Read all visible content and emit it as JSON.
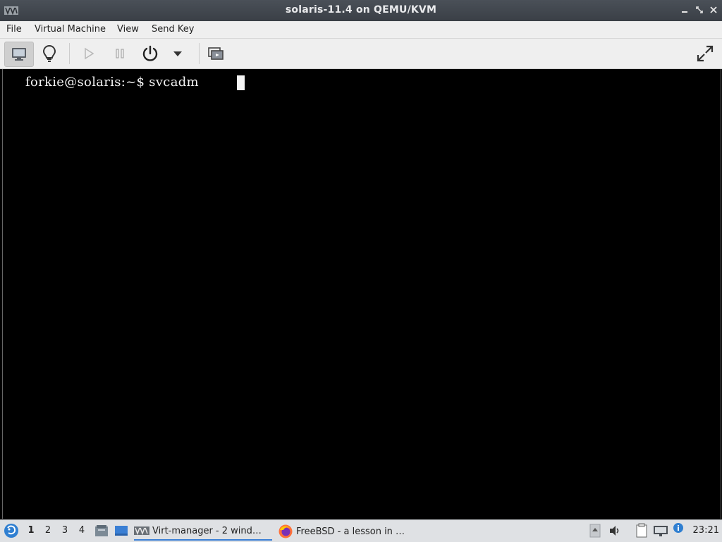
{
  "window": {
    "title": "solaris-11.4 on QEMU/KVM",
    "controls": [
      "minimize",
      "maximize",
      "close"
    ]
  },
  "menubar": {
    "items": [
      "File",
      "Virtual Machine",
      "View",
      "Send Key"
    ]
  },
  "toolbar": {
    "buttons": [
      {
        "name": "show-console",
        "icon": "monitor-icon",
        "active": true
      },
      {
        "name": "show-details",
        "icon": "lightbulb-icon",
        "active": false
      },
      {
        "name": "run",
        "icon": "play-icon",
        "enabled": false
      },
      {
        "name": "pause",
        "icon": "pause-icon",
        "enabled": false
      },
      {
        "name": "shutdown",
        "icon": "power-icon",
        "enabled": true
      },
      {
        "name": "shutdown-menu",
        "icon": "caret-down-icon",
        "enabled": true
      },
      {
        "name": "snapshots",
        "icon": "snapshot-icon",
        "enabled": true
      },
      {
        "name": "fullscreen",
        "icon": "fullscreen-icon",
        "enabled": true
      }
    ]
  },
  "console": {
    "prompt": "forkie@solaris:~$ svcadm "
  },
  "taskbar": {
    "workspaces": [
      "1",
      "2",
      "3",
      "4"
    ],
    "active_workspace": "1",
    "tasks": [
      {
        "label": "Virt-manager - 2 wind…",
        "icon": "virt-manager-icon",
        "active": true
      },
      {
        "label": "FreeBSD - a lesson in …",
        "icon": "firefox-icon",
        "active": false
      }
    ],
    "clock": "23:21"
  },
  "colors": {
    "titlebar": "#3f444b",
    "menubar": "#efefef",
    "console_bg": "#000000",
    "taskbar": "#dfe1e4",
    "accent": "#3b7fd6"
  }
}
